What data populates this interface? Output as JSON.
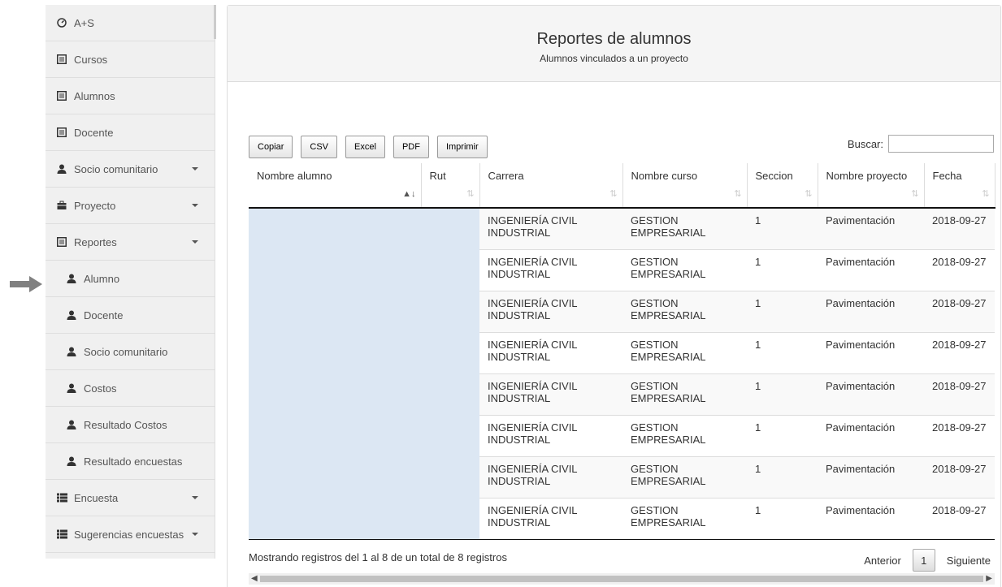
{
  "sidebar": {
    "items": [
      {
        "label": "A+S",
        "icon": "dashboard-icon",
        "caret": false,
        "sub": false
      },
      {
        "label": "Cursos",
        "icon": "list-icon",
        "caret": false,
        "sub": false
      },
      {
        "label": "Alumnos",
        "icon": "list-icon",
        "caret": false,
        "sub": false
      },
      {
        "label": "Docente",
        "icon": "list-icon",
        "caret": false,
        "sub": false
      },
      {
        "label": "Socio comunitario",
        "icon": "user-icon",
        "caret": true,
        "sub": false
      },
      {
        "label": "Proyecto",
        "icon": "briefcase-icon",
        "caret": true,
        "sub": false
      },
      {
        "label": "Reportes",
        "icon": "list-icon",
        "caret": true,
        "sub": false
      },
      {
        "label": "Alumno",
        "icon": "user-icon",
        "caret": false,
        "sub": true
      },
      {
        "label": "Docente",
        "icon": "user-icon",
        "caret": false,
        "sub": true
      },
      {
        "label": "Socio comunitario",
        "icon": "user-icon",
        "caret": false,
        "sub": true
      },
      {
        "label": "Costos",
        "icon": "user-icon",
        "caret": false,
        "sub": true
      },
      {
        "label": "Resultado Costos",
        "icon": "user-icon",
        "caret": false,
        "sub": true
      },
      {
        "label": "Resultado encuestas",
        "icon": "user-icon",
        "caret": false,
        "sub": true
      },
      {
        "label": "Encuesta",
        "icon": "th-list-icon",
        "caret": true,
        "sub": false
      },
      {
        "label": "Sugerencias encuestas",
        "icon": "th-list-icon",
        "caret": true,
        "sub": false
      }
    ]
  },
  "panel": {
    "title": "Reportes de alumnos",
    "subtitle": "Alumnos vinculados a un proyecto"
  },
  "toolbar": {
    "copy": "Copiar",
    "csv": "CSV",
    "excel": "Excel",
    "pdf": "PDF",
    "print": "Imprimir"
  },
  "search": {
    "label": "Buscar:",
    "value": ""
  },
  "table": {
    "headers": [
      "Nombre alumno",
      "Rut",
      "Carrera",
      "Nombre curso",
      "Seccion",
      "Nombre proyecto",
      "Fecha"
    ],
    "rows": [
      [
        "",
        "",
        "INGENIERÍA CIVIL INDUSTRIAL",
        "GESTION EMPRESARIAL",
        "1",
        "Pavimentación",
        "2018-09-27"
      ],
      [
        "",
        "",
        "INGENIERÍA CIVIL INDUSTRIAL",
        "GESTION EMPRESARIAL",
        "1",
        "Pavimentación",
        "2018-09-27"
      ],
      [
        "",
        "",
        "INGENIERÍA CIVIL INDUSTRIAL",
        "GESTION EMPRESARIAL",
        "1",
        "Pavimentación",
        "2018-09-27"
      ],
      [
        "",
        "",
        "INGENIERÍA CIVIL INDUSTRIAL",
        "GESTION EMPRESARIAL",
        "1",
        "Pavimentación",
        "2018-09-27"
      ],
      [
        "",
        "",
        "INGENIERÍA CIVIL INDUSTRIAL",
        "GESTION EMPRESARIAL",
        "1",
        "Pavimentación",
        "2018-09-27"
      ],
      [
        "",
        "",
        "INGENIERÍA CIVIL INDUSTRIAL",
        "GESTION EMPRESARIAL",
        "1",
        "Pavimentación",
        "2018-09-27"
      ],
      [
        "",
        "",
        "INGENIERÍA CIVIL INDUSTRIAL",
        "GESTION EMPRESARIAL",
        "1",
        "Pavimentación",
        "2018-09-27"
      ],
      [
        "",
        "",
        "INGENIERÍA CIVIL INDUSTRIAL",
        "GESTION EMPRESARIAL",
        "1",
        "Pavimentación",
        "2018-09-27"
      ]
    ]
  },
  "footer": {
    "info": "Mostrando registros del 1 al 8 de un total de 8 registros",
    "prev": "Anterior",
    "page": "1",
    "next": "Siguiente"
  },
  "colors": {
    "arrow": "#808080",
    "selection": "#dce7f3",
    "sidebar_bg": "#f0f0f0"
  }
}
